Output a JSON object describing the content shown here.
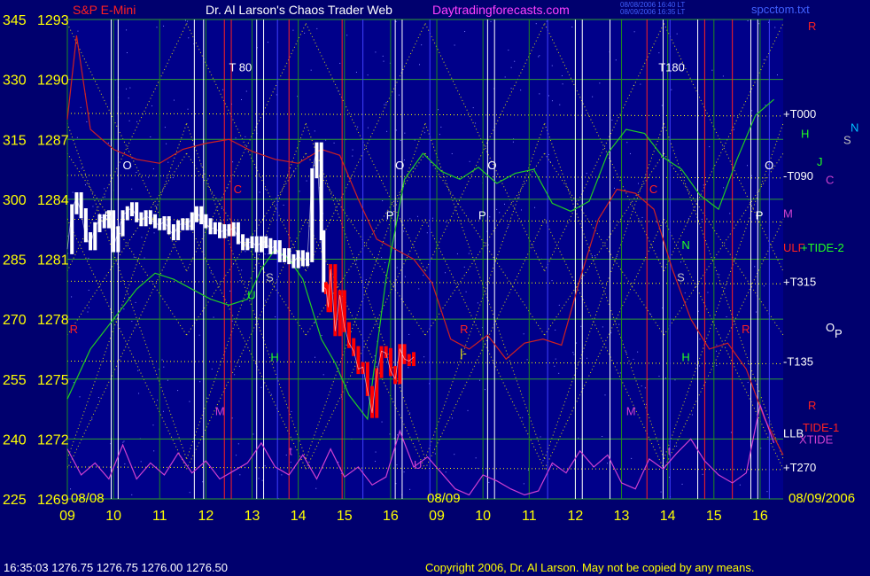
{
  "header": {
    "symbol": "S&P E-Mini",
    "title": "Dr. Al Larson's Chaos Trader Web",
    "site": "Daytradingforecasts.com",
    "file": "spcctom.txt",
    "stamp_lines": [
      "08/08/2006 16:40 LT",
      "08/09/2006 16:35 LT"
    ]
  },
  "footer": {
    "quote": "16:35:03  1276.75 1276.75 1276.00 1276.50",
    "copyright": "Copyright 2006, Dr. Al Larson. May not be copied by any means."
  },
  "colors": {
    "background": "#00006e",
    "plot_area": "#00008a",
    "price_up": "#ffffff",
    "price_down": "#ff0000",
    "grid_green": "#2ea02e",
    "yellow": "#ffff00",
    "text_yellow": "#ffff00",
    "magenta": "#d040d0",
    "red_line": "#d02020",
    "green_line": "#22cc22",
    "white_line": "#ffffff",
    "cyan": "#00c0c0"
  },
  "chart_data": {
    "type": "line",
    "y_left_labels": [
      "345",
      "330",
      "315",
      "300",
      "285",
      "270",
      "255",
      "240",
      "225"
    ],
    "y_price_labels": [
      "1293",
      "1290",
      "1287",
      "1284",
      "1281",
      "1278",
      "1275",
      "1272",
      "1269"
    ],
    "ylim": [
      1269,
      1293
    ],
    "x_ticks": [
      "09",
      "10",
      "11",
      "12",
      "13",
      "14",
      "15",
      "16",
      "09",
      "10",
      "11",
      "12",
      "13",
      "14",
      "15",
      "16"
    ],
    "date_labels": [
      "08/08",
      "08/09",
      "08/09/2006"
    ],
    "right_labels": [
      {
        "text": "R",
        "color": "#ff2020",
        "price": 1292.7
      },
      {
        "text": "+T000",
        "color": "#ffffff",
        "price": 1288.3
      },
      {
        "text": "H",
        "color": "#20ff20",
        "price": 1287.3
      },
      {
        "text": "N",
        "color": "#00c0ff",
        "price": 1287.6
      },
      {
        "text": "S",
        "color": "#c0c0c0",
        "price": 1287.0
      },
      {
        "text": "J",
        "color": "#20ff20",
        "price": 1285.9
      },
      {
        "text": "-T090",
        "color": "#ffffff",
        "price": 1285.2
      },
      {
        "text": "C",
        "color": "#d040d0",
        "price": 1285.0
      },
      {
        "text": "M",
        "color": "#d040d0",
        "price": 1283.3
      },
      {
        "text": "ULF",
        "color": "#ff2020",
        "price": 1281.6
      },
      {
        "text": "+TIDE-2",
        "color": "#20ff20",
        "price": 1281.6
      },
      {
        "text": "+T315",
        "color": "#ffffff",
        "price": 1279.9
      },
      {
        "text": "O",
        "color": "#ffffff",
        "price": 1277.6
      },
      {
        "text": "P",
        "color": "#ffffff",
        "price": 1277.3
      },
      {
        "text": "-T135",
        "color": "#ffffff",
        "price": 1275.9
      },
      {
        "text": "R",
        "color": "#ff2020",
        "price": 1273.7
      },
      {
        "text": "TIDE-1",
        "color": "#ff2020",
        "price": 1272.6
      },
      {
        "text": "LLB",
        "color": "#ffffff",
        "price": 1272.3
      },
      {
        "text": "XTIDE",
        "color": "#d040d0",
        "price": 1272.0
      },
      {
        "text": "+T270",
        "color": "#ffffff",
        "price": 1270.6
      }
    ],
    "plot_annotations": [
      {
        "text": "T 80",
        "color": "#ffffff",
        "time": 12.0,
        "price": 1290.4
      },
      {
        "text": "T180",
        "color": "#ffffff",
        "time": 21.3,
        "price": 1290.4
      },
      {
        "text": "O",
        "color": "#ffffff",
        "time": 9.7,
        "price": 1285.5
      },
      {
        "text": "O",
        "color": "#ffffff",
        "time": 15.6,
        "price": 1285.5
      },
      {
        "text": "O",
        "color": "#ffffff",
        "time": 17.6,
        "price": 1285.5
      },
      {
        "text": "O",
        "color": "#ffffff",
        "time": 23.6,
        "price": 1285.5
      },
      {
        "text": "P",
        "color": "#ffffff",
        "time": 9.3,
        "price": 1283.0
      },
      {
        "text": "P",
        "color": "#ffffff",
        "time": 15.4,
        "price": 1283.0
      },
      {
        "text": "P",
        "color": "#ffffff",
        "time": 17.4,
        "price": 1283.0
      },
      {
        "text": "P",
        "color": "#ffffff",
        "time": 23.4,
        "price": 1283.0
      },
      {
        "text": "C",
        "color": "#ff2020",
        "time": 12.1,
        "price": 1284.3
      },
      {
        "text": "C",
        "color": "#ff2020",
        "time": 21.1,
        "price": 1284.3
      },
      {
        "text": "N",
        "color": "#20ff20",
        "time": 21.8,
        "price": 1281.5
      },
      {
        "text": "S",
        "color": "#c0c0c0",
        "time": 12.8,
        "price": 1279.9
      },
      {
        "text": "S",
        "color": "#c0c0c0",
        "time": 21.7,
        "price": 1279.9
      },
      {
        "text": "U",
        "color": "#20ff20",
        "time": 12.4,
        "price": 1279.0
      },
      {
        "text": "H",
        "color": "#20ff20",
        "time": 12.9,
        "price": 1275.9
      },
      {
        "text": "H",
        "color": "#20ff20",
        "time": 21.8,
        "price": 1275.9
      },
      {
        "text": "R",
        "color": "#ff2020",
        "time": 8.55,
        "price": 1277.3
      },
      {
        "text": "R",
        "color": "#ff2020",
        "time": 17.0,
        "price": 1277.3
      },
      {
        "text": "R",
        "color": "#ff2020",
        "time": 23.1,
        "price": 1277.3
      },
      {
        "text": "M",
        "color": "#d040d0",
        "time": 11.7,
        "price": 1273.2
      },
      {
        "text": "M",
        "color": "#d040d0",
        "time": 20.6,
        "price": 1273.2
      },
      {
        "text": "t",
        "color": "#d040d0",
        "time": 13.3,
        "price": 1271.2
      },
      {
        "text": "t",
        "color": "#d040d0",
        "time": 21.5,
        "price": 1271.2
      },
      {
        "text": "U",
        "color": "#d040d0",
        "time": 16.0,
        "price": 1270.5
      },
      {
        "text": "|-",
        "color": "#ffff00",
        "time": 17.0,
        "price": 1276.1
      }
    ],
    "price_series": {
      "name": "S&P E-Mini",
      "time": [
        8.5,
        8.6,
        8.7,
        8.8,
        8.9,
        9.0,
        9.1,
        9.2,
        9.3,
        9.4,
        9.5,
        9.6,
        9.7,
        9.8,
        9.9,
        10.0,
        10.1,
        10.2,
        10.3,
        10.4,
        10.5,
        10.6,
        10.7,
        10.8,
        10.9,
        11.0,
        11.1,
        11.2,
        11.3,
        11.4,
        11.5,
        11.6,
        11.7,
        11.8,
        11.9,
        12.0,
        12.1,
        12.2,
        12.3,
        12.4,
        12.5,
        12.6,
        12.7,
        12.8,
        12.9,
        13.0,
        13.1,
        13.2,
        13.3,
        13.4,
        13.5,
        13.6,
        13.7,
        13.8,
        13.9,
        14.0,
        14.05,
        14.1,
        14.15,
        14.2,
        14.3,
        14.4,
        14.5,
        14.6,
        14.7,
        14.8,
        14.9,
        15.0,
        15.1,
        15.2,
        15.3,
        15.4,
        15.5,
        15.6,
        15.7,
        15.8,
        15.9,
        16.0
      ],
      "close": [
        1281.5,
        1283.5,
        1284.1,
        1283.3,
        1282.1,
        1281.7,
        1282.6,
        1283.0,
        1282.8,
        1283.2,
        1281.6,
        1282.4,
        1283.2,
        1283.4,
        1283.6,
        1283.1,
        1282.9,
        1283.2,
        1283.0,
        1282.8,
        1282.7,
        1282.9,
        1282.5,
        1282.2,
        1282.7,
        1282.8,
        1282.7,
        1283.1,
        1283.4,
        1283.0,
        1282.8,
        1282.5,
        1282.6,
        1282.3,
        1282.5,
        1282.4,
        1282.6,
        1282.0,
        1281.7,
        1281.8,
        1281.9,
        1281.6,
        1281.9,
        1281.8,
        1281.5,
        1281.7,
        1281.1,
        1281.3,
        1281.0,
        1280.8,
        1281.2,
        1280.9,
        1281.1,
        1285.3,
        1286.6,
        1282.2,
        1279.6,
        1279.5,
        1278.6,
        1280.5,
        1277.4,
        1279.2,
        1277.6,
        1276.8,
        1276.4,
        1275.5,
        1275.6,
        1274.4,
        1273.3,
        1275.3,
        1276.4,
        1276.3,
        1275.4,
        1275.0,
        1276.5,
        1276.0,
        1275.9,
        1276.1
      ]
    },
    "green_line": {
      "name": "",
      "time": [
        8.5,
        9.0,
        9.5,
        10.0,
        10.4,
        10.8,
        11.2,
        11.6,
        12.0,
        12.4,
        12.7,
        13.0,
        13.3,
        13.6,
        14.0,
        14.3,
        14.6,
        15.0,
        15.4,
        15.8,
        16.2,
        16.6,
        17.0,
        17.4,
        17.8,
        18.2,
        18.6,
        19.0,
        19.4,
        19.8,
        20.2,
        20.6,
        21.0,
        21.4,
        21.8,
        22.2,
        22.6,
        23.0,
        23.4,
        23.8
      ],
      "value": [
        1274.0,
        1276.5,
        1278.0,
        1279.5,
        1280.3,
        1280.0,
        1279.5,
        1279.0,
        1278.7,
        1279.0,
        1280.5,
        1281.5,
        1281.0,
        1280.0,
        1277.0,
        1275.8,
        1274.2,
        1273.0,
        1280.0,
        1285.0,
        1286.3,
        1285.4,
        1285.0,
        1285.6,
        1284.8,
        1285.3,
        1285.5,
        1283.8,
        1283.4,
        1283.9,
        1286.3,
        1287.5,
        1287.3,
        1286.1,
        1285.5,
        1284.2,
        1283.5,
        1286.0,
        1288.2,
        1289.0
      ]
    },
    "red_line": {
      "name": "",
      "time": [
        8.5,
        8.7,
        9.0,
        9.5,
        10.0,
        10.5,
        11.0,
        11.5,
        12.0,
        12.5,
        13.0,
        13.5,
        14.0,
        14.4,
        14.8,
        15.2,
        15.6,
        16.0,
        16.4,
        16.8,
        17.2,
        17.6,
        18.0,
        18.4,
        18.8,
        19.2,
        19.6,
        20.0,
        20.4,
        20.8,
        21.2,
        21.6,
        22.0,
        22.4,
        22.8,
        23.2,
        23.6,
        24.0
      ],
      "value": [
        1288.0,
        1292.2,
        1287.5,
        1286.5,
        1286.0,
        1285.8,
        1286.5,
        1286.8,
        1287.0,
        1286.4,
        1286.0,
        1285.8,
        1286.5,
        1286.2,
        1284.0,
        1282.0,
        1281.5,
        1281.0,
        1279.8,
        1277.0,
        1276.5,
        1277.2,
        1276.0,
        1276.8,
        1277.0,
        1276.7,
        1280.0,
        1283.0,
        1284.5,
        1284.3,
        1283.5,
        1280.5,
        1278.0,
        1276.5,
        1276.8,
        1275.5,
        1273.0,
        1271.2
      ]
    },
    "magenta_line": {
      "name": "",
      "time": [
        8.5,
        8.8,
        9.1,
        9.4,
        9.7,
        10.0,
        10.3,
        10.6,
        10.9,
        11.2,
        11.5,
        11.8,
        12.1,
        12.4,
        12.7,
        13.0,
        13.3,
        13.6,
        13.9,
        14.2,
        14.5,
        14.8,
        15.1,
        15.4,
        15.7,
        16.0,
        16.3,
        16.6,
        16.9,
        17.2,
        17.5,
        17.8,
        18.1,
        18.4,
        18.7,
        19.0,
        19.3,
        19.6,
        19.9,
        20.2,
        20.5,
        20.8,
        21.1,
        21.4,
        21.7,
        22.0,
        22.3,
        22.6,
        22.9,
        23.2,
        23.5,
        23.8
      ],
      "value": [
        1271.5,
        1270.2,
        1270.8,
        1270.0,
        1271.7,
        1270.0,
        1270.8,
        1270.2,
        1271.3,
        1270.3,
        1270.9,
        1270.0,
        1270.4,
        1270.8,
        1271.8,
        1270.6,
        1270.2,
        1271.2,
        1270.0,
        1271.5,
        1270.1,
        1270.6,
        1269.7,
        1270.1,
        1272.4,
        1270.6,
        1271.1,
        1270.3,
        1269.5,
        1269.2,
        1270.2,
        1269.9,
        1269.5,
        1269.2,
        1269.4,
        1270.8,
        1270.3,
        1271.4,
        1270.6,
        1271.2,
        1269.8,
        1269.5,
        1271.0,
        1270.5,
        1271.3,
        1272.0,
        1270.9,
        1270.2,
        1269.8,
        1270.3,
        1273.7,
        1271.8
      ]
    }
  }
}
